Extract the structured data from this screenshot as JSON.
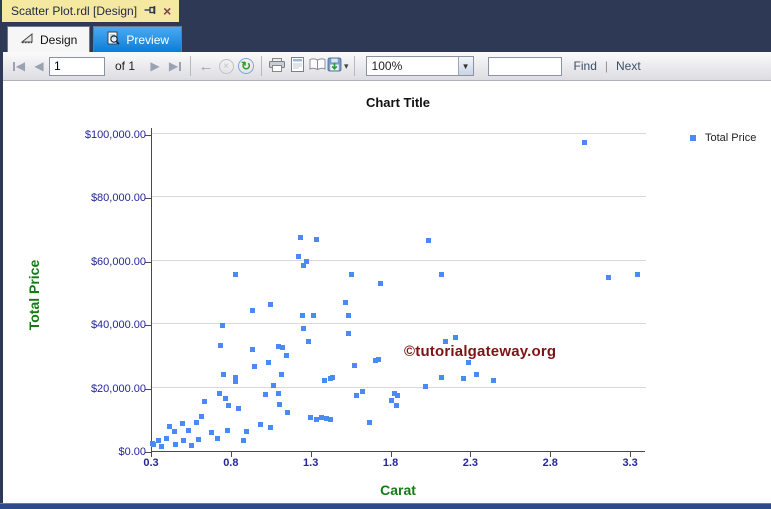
{
  "window": {
    "title": "Scatter Plot.rdl [Design]"
  },
  "tabs": {
    "design": "Design",
    "preview": "Preview"
  },
  "toolbar": {
    "page_number": "1",
    "of_label": "of 1",
    "zoom_value": "100%",
    "find_label": "Find",
    "find_next_separator": "|",
    "next_label": "Next"
  },
  "watermark": "©tutorialgateway.org",
  "colors": {
    "marker_blue": "#4a8af4",
    "axis_title_green": "#157a15",
    "tick_label_navy": "#26269a",
    "watermark_red": "#7c1416",
    "active_file_tab_yellow": "#f5e9a2",
    "preview_tab_blue": "#1588d6",
    "frame_dark_navy": "#2e3a55",
    "status_bar_blue": "#2d4a8a"
  },
  "chart_data": {
    "type": "scatter",
    "title": "Chart Title",
    "xlabel": "Carat",
    "ylabel": "Total Price",
    "grid": "horizontal",
    "legend_position": "right",
    "legend": [
      {
        "label": "Total Price",
        "color": "#4a8af4"
      }
    ],
    "xlim": [
      0.3,
      3.4
    ],
    "ylim": [
      0,
      100000
    ],
    "x_ticks": [
      0.3,
      0.8,
      1.3,
      1.8,
      2.3,
      2.8,
      3.3
    ],
    "x_tick_labels": [
      "0.3",
      "0.8",
      "1.3",
      "1.8",
      "2.3",
      "2.8",
      "3.3"
    ],
    "y_ticks": [
      0,
      20000,
      40000,
      60000,
      80000,
      100000
    ],
    "y_tick_labels": [
      "$0.00",
      "$20,000.00",
      "$40,000.00",
      "$60,000.00",
      "$80,000.00",
      "$100,000.00"
    ],
    "series": [
      {
        "name": "Total Price",
        "marker": "square",
        "color": "#4a8af4",
        "points": [
          [
            0.82,
            21800
          ],
          [
            1.06,
            20800
          ],
          [
            0.72,
            18300
          ],
          [
            0.76,
            16700
          ],
          [
            1.01,
            17700
          ],
          [
            1.09,
            18300
          ],
          [
            0.63,
            15500
          ],
          [
            0.78,
            14500
          ],
          [
            1.1,
            14800
          ],
          [
            0.84,
            13300
          ],
          [
            1.15,
            12000
          ],
          [
            1.29,
            10700
          ],
          [
            0.58,
            9100
          ],
          [
            0.49,
            8800
          ],
          [
            0.61,
            11000
          ],
          [
            1.33,
            9800
          ],
          [
            0.41,
            7600
          ],
          [
            0.53,
            6600
          ],
          [
            0.77,
            6600
          ],
          [
            0.44,
            6000
          ],
          [
            0.67,
            5700
          ],
          [
            0.89,
            6000
          ],
          [
            0.98,
            8500
          ],
          [
            1.04,
            7300
          ],
          [
            0.34,
            3200
          ],
          [
            0.39,
            3800
          ],
          [
            0.5,
            3200
          ],
          [
            0.59,
            3500
          ],
          [
            0.71,
            3800
          ],
          [
            0.87,
            3200
          ],
          [
            0.3,
            2500
          ],
          [
            0.31,
            1900
          ],
          [
            0.45,
            1900
          ],
          [
            0.55,
            1600
          ],
          [
            0.36,
            1300
          ],
          [
            0.93,
            44200
          ],
          [
            1.04,
            46100
          ],
          [
            1.24,
            42600
          ],
          [
            1.31,
            42600
          ],
          [
            0.74,
            39700
          ],
          [
            1.25,
            38800
          ],
          [
            0.73,
            33400
          ],
          [
            1.28,
            34400
          ],
          [
            0.93,
            31900
          ],
          [
            1.09,
            33100
          ],
          [
            1.12,
            32500
          ],
          [
            1.14,
            30000
          ],
          [
            0.94,
            26800
          ],
          [
            1.03,
            27800
          ],
          [
            0.75,
            24000
          ],
          [
            0.82,
            23300
          ],
          [
            1.11,
            24000
          ],
          [
            1.38,
            22100
          ],
          [
            1.42,
            23000
          ],
          [
            1.23,
            67200
          ],
          [
            1.33,
            66600
          ],
          [
            1.22,
            61500
          ],
          [
            1.27,
            59900
          ],
          [
            1.25,
            58400
          ],
          [
            0.82,
            55800
          ],
          [
            2.03,
            66300
          ],
          [
            1.55,
            55800
          ],
          [
            2.11,
            55800
          ],
          [
            1.73,
            53000
          ],
          [
            1.51,
            46700
          ],
          [
            1.53,
            42900
          ],
          [
            1.53,
            37200
          ],
          [
            2.14,
            34400
          ],
          [
            2.2,
            35700
          ],
          [
            2.28,
            27800
          ],
          [
            1.7,
            28700
          ],
          [
            1.72,
            29000
          ],
          [
            1.57,
            27100
          ],
          [
            1.43,
            23300
          ],
          [
            2.11,
            23300
          ],
          [
            2.33,
            24000
          ],
          [
            2.25,
            23000
          ],
          [
            2.44,
            22400
          ],
          [
            2.01,
            20200
          ],
          [
            1.62,
            18900
          ],
          [
            1.58,
            17400
          ],
          [
            1.8,
            15800
          ],
          [
            1.84,
            17400
          ],
          [
            1.82,
            18300
          ],
          [
            1.83,
            14500
          ],
          [
            1.36,
            10700
          ],
          [
            1.39,
            10400
          ],
          [
            1.42,
            9800
          ],
          [
            1.66,
            9100
          ],
          [
            3.01,
            97200
          ],
          [
            3.16,
            54600
          ],
          [
            3.34,
            55800
          ]
        ]
      }
    ]
  }
}
